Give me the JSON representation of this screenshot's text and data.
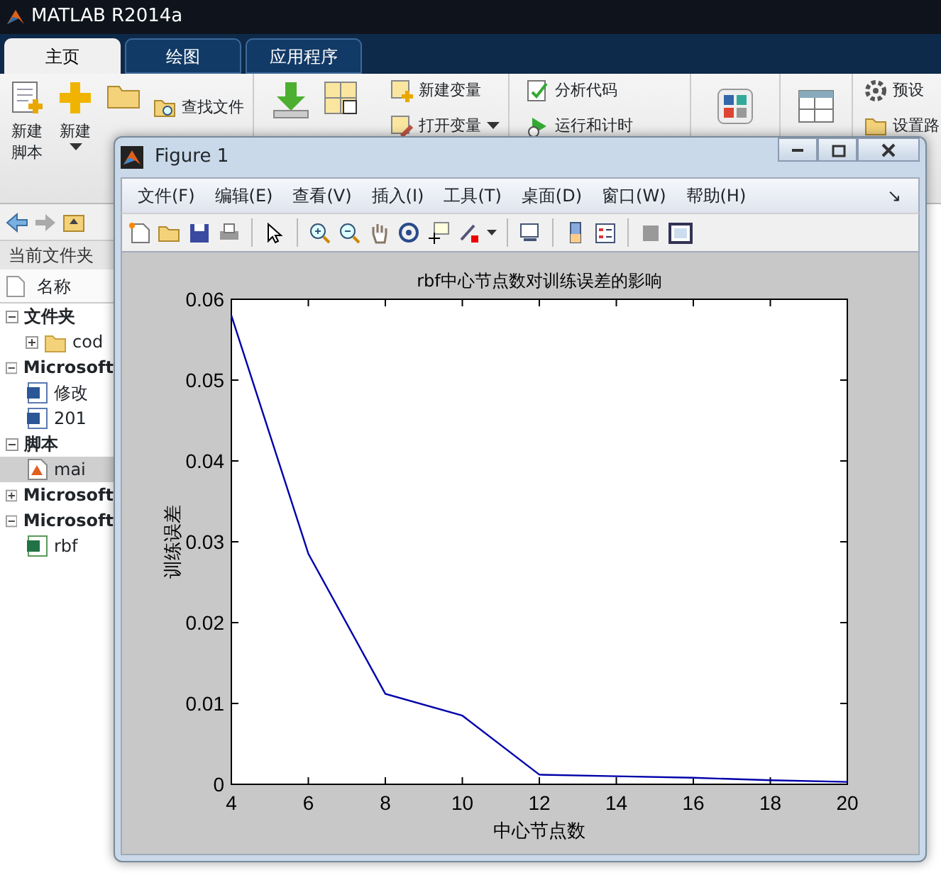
{
  "window": {
    "title": "MATLAB R2014a"
  },
  "tabs": [
    {
      "label": "主页",
      "selected": true
    },
    {
      "label": "绘图",
      "selected": false
    },
    {
      "label": "应用程序",
      "selected": false
    }
  ],
  "ribbon": {
    "new_script": "新建脚本",
    "new": "新建",
    "find_files": "查找文件",
    "new_variable": "新建变量",
    "open_variable": "打开变量",
    "analyze_code": "分析代码",
    "run_and_time": "运行和计时",
    "preferences": "预设",
    "set_path": "设置路"
  },
  "current_folder": {
    "title": "当前文件夹",
    "column": "名称",
    "tree": [
      {
        "label": "文件夹",
        "kind": "group",
        "expanded": true,
        "selected": false,
        "children": [
          {
            "label": "cod",
            "kind": "folder",
            "expanded": false,
            "selected": false
          }
        ]
      },
      {
        "label": "Microsoft",
        "kind": "group",
        "expanded": true,
        "selected": false,
        "children": [
          {
            "label": "修改",
            "kind": "document",
            "selected": false
          },
          {
            "label": "201",
            "kind": "document",
            "selected": false
          }
        ]
      },
      {
        "label": "脚本",
        "kind": "group",
        "expanded": true,
        "selected": false,
        "children": [
          {
            "label": "mai",
            "kind": "script",
            "selected": true
          }
        ]
      },
      {
        "label": "Microsoft",
        "kind": "group",
        "expanded": false,
        "selected": false
      },
      {
        "label": "Microsoft",
        "kind": "group",
        "expanded": true,
        "selected": false,
        "children": [
          {
            "label": "rbf",
            "kind": "spreadsheet",
            "selected": false
          }
        ]
      }
    ]
  },
  "figure": {
    "title": "Figure 1",
    "menu": [
      "文件(F)",
      "编辑(E)",
      "查看(V)",
      "插入(I)",
      "工具(T)",
      "桌面(D)",
      "窗口(W)",
      "帮助(H)"
    ],
    "dock_glyph": "↘",
    "chart_data": {
      "type": "line",
      "title": "rbf中心节点数对训练误差的影响",
      "xlabel": "中心节点数",
      "ylabel": "训练误差",
      "x": [
        4,
        6,
        8,
        10,
        12,
        14,
        16,
        18,
        20
      ],
      "series": [
        {
          "color": "#0000aa",
          "values": [
            0.058,
            0.0285,
            0.0112,
            0.0085,
            0.0012,
            0.001,
            0.0008,
            0.0005,
            0.0003
          ]
        }
      ],
      "xlim": [
        4,
        20
      ],
      "ylim": [
        0,
        0.06
      ],
      "xticks": [
        4,
        6,
        8,
        10,
        12,
        14,
        16,
        18,
        20
      ],
      "yticks": [
        0,
        0.01,
        0.02,
        0.03,
        0.04,
        0.05,
        0.06
      ]
    }
  }
}
